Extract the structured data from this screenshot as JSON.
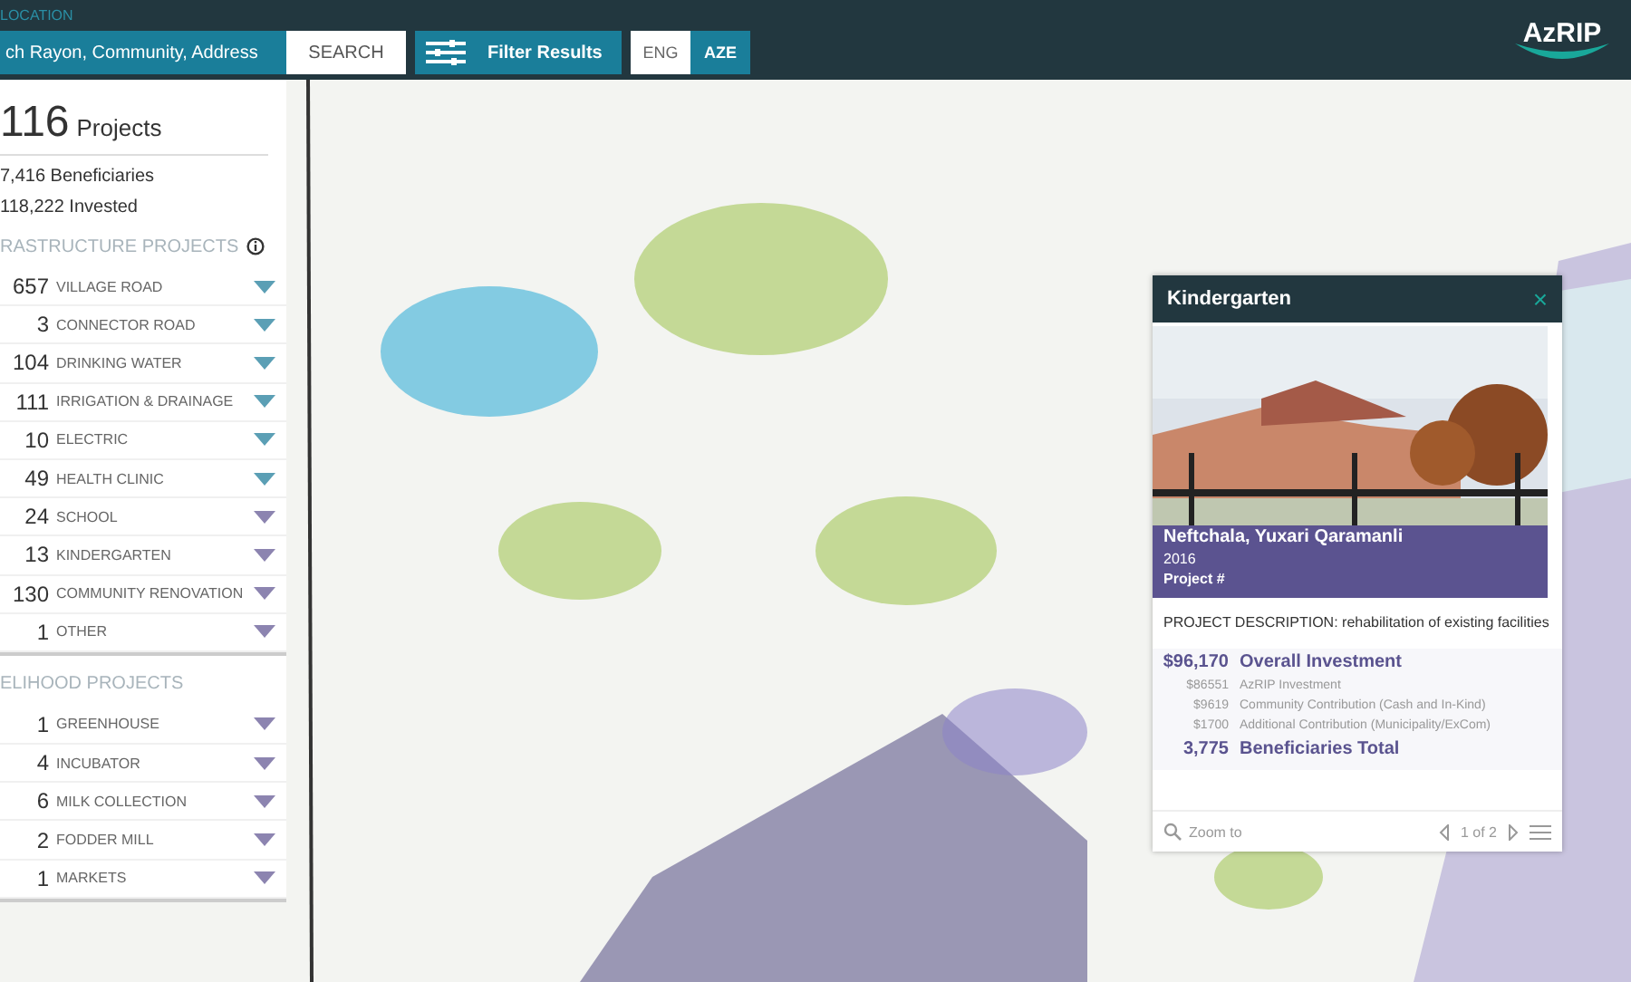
{
  "header": {
    "section_label": "LOCATION",
    "search": {
      "placeholder": "ch Rayon, Community, Address"
    },
    "search_button": "SEARCH",
    "filter_button": "Filter Results",
    "languages": [
      {
        "label": "ENG",
        "selected": false
      },
      {
        "label": "AZE",
        "selected": true
      }
    ],
    "logo": "AzRIP"
  },
  "summary": {
    "count": "116",
    "count_label": "Projects",
    "beneficiaries": "7,416 Beneficiaries",
    "invested": "118,222 Invested"
  },
  "groups": [
    {
      "title": "RASTRUCTURE PROJECTS",
      "info": true,
      "items": [
        {
          "count": "657",
          "label": "VILLAGE ROAD",
          "color": "#5b9fb5"
        },
        {
          "count": "3",
          "label": "CONNECTOR ROAD",
          "color": "#5b9fb5"
        },
        {
          "count": "104",
          "label": "DRINKING WATER",
          "color": "#5b9fb5"
        },
        {
          "count": "111",
          "label": "IRRIGATION & DRAINAGE",
          "color": "#5b9fb5"
        },
        {
          "count": "10",
          "label": "ELECTRIC",
          "color": "#5b9fb5"
        },
        {
          "count": "49",
          "label": "HEALTH CLINIC",
          "color": "#5b9fb5"
        },
        {
          "count": "24",
          "label": "SCHOOL",
          "color": "#8c84b0"
        },
        {
          "count": "13",
          "label": "KINDERGARTEN",
          "color": "#8c84b0"
        },
        {
          "count": "130",
          "label": "COMMUNITY RENOVATION",
          "color": "#8c84b0"
        },
        {
          "count": "1",
          "label": "OTHER",
          "color": "#8c84b0"
        }
      ]
    },
    {
      "title": "ELIHOOD PROJECTS",
      "info": false,
      "items": [
        {
          "count": "1",
          "label": "GREENHOUSE",
          "color": "#8c84b0"
        },
        {
          "count": "4",
          "label": "INCUBATOR",
          "color": "#8c84b0"
        },
        {
          "count": "6",
          "label": "MILK COLLECTION",
          "color": "#8c84b0"
        },
        {
          "count": "2",
          "label": "FODDER MILL",
          "color": "#8c84b0"
        },
        {
          "count": "1",
          "label": "MARKETS",
          "color": "#8c84b0"
        }
      ]
    }
  ],
  "popup": {
    "title": "Kindergarten",
    "close": "×",
    "place": "Neftchala, Yuxari Qaramanli",
    "year": "2016",
    "project_label": "Project #",
    "description": "PROJECT DESCRIPTION: rehabilitation of existing facilities",
    "finance": [
      {
        "kind": "total",
        "amount": "$96,170",
        "label": "Overall Investment"
      },
      {
        "kind": "part",
        "amount": "$86551",
        "label": "AzRIP Investment"
      },
      {
        "kind": "part",
        "amount": "$9619",
        "label": "Community Contribution (Cash and In-Kind)"
      },
      {
        "kind": "part",
        "amount": "$1700",
        "label": "Additional Contribution (Municipality/ExCom)"
      },
      {
        "kind": "total",
        "amount": "3,775",
        "label": "Beneficiaries Total"
      }
    ],
    "zoom_label": "Zoom to",
    "pager": "1 of 2"
  }
}
